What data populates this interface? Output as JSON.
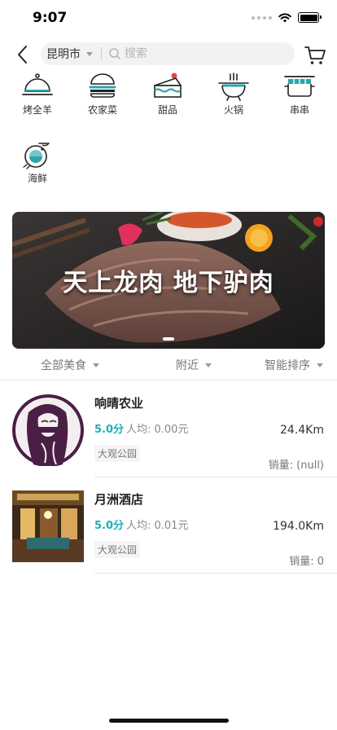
{
  "status_bar": {
    "time": "9:07"
  },
  "header": {
    "city": "昆明市",
    "search_placeholder": "搜索",
    "icons": {
      "back": "chevron-left-icon",
      "search": "search-icon",
      "cart": "cart-icon"
    }
  },
  "categories": [
    {
      "label": "烤全羊",
      "icon": "cloche-icon"
    },
    {
      "label": "农家菜",
      "icon": "burger-icon"
    },
    {
      "label": "甜品",
      "icon": "cake-icon"
    },
    {
      "label": "火锅",
      "icon": "hotpot-icon"
    },
    {
      "label": "串串",
      "icon": "skewer-pot-icon"
    },
    {
      "label": "海鲜",
      "icon": "shrimp-icon"
    }
  ],
  "banner": {
    "text": "天上龙肉 地下驴肉",
    "page_count": 1
  },
  "filters": {
    "all_food": "全部美食",
    "nearby": "附近",
    "smart_sort": "智能排序"
  },
  "shops": [
    {
      "name": "响晴农业",
      "rating": "5.0分",
      "avg_price": "人均: 0.00元",
      "tag": "大观公园",
      "distance": "24.4Km",
      "sales": "销量: (null)"
    },
    {
      "name": "月洲酒店",
      "rating": "5.0分",
      "avg_price": "人均: 0.01元",
      "tag": "大观公园",
      "distance": "194.0Km",
      "sales": "销量: 0"
    }
  ],
  "colors": {
    "accent": "#1ab0b6",
    "icon_teal": "#2ba6ab",
    "cake_red": "#e04747"
  }
}
